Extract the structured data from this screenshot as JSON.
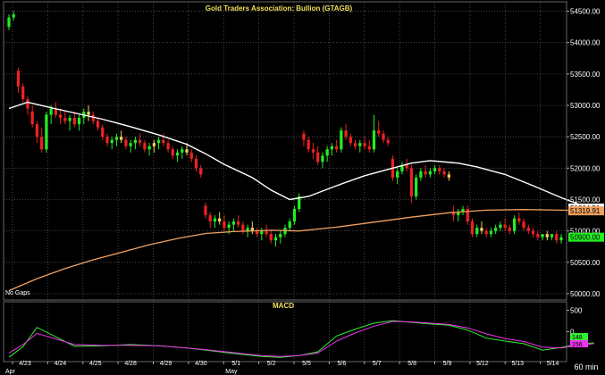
{
  "window": {
    "time_frame": "60 min"
  },
  "chart_data": [
    {
      "type": "candlestick",
      "title": "Gold Traders Association: Bullion (GTAGB)",
      "note": "No Gaps",
      "x_tick_labels": [
        "4/23",
        "4/24",
        "4/25",
        "4/28",
        "4/29",
        "4/30",
        "5/1",
        "5/2",
        "5/5",
        "5/6",
        "5/7",
        "5/8",
        "5/9",
        "5/12",
        "5/13",
        "5/14"
      ],
      "x_month_labels": [
        "Apr",
        "May"
      ],
      "y_tick_labels": [
        "50000.00",
        "50500.00",
        "51000.00",
        "51500.00",
        "52000.00",
        "52500.00",
        "53000.00",
        "53500.00",
        "54000.00",
        "54500.00"
      ],
      "ylim": [
        49900,
        54650
      ],
      "price_tags": {
        "last_price": "50900.00",
        "slow_average": "51319.91",
        "fast_average": "51364.51"
      },
      "colors": {
        "up": "#22ee22",
        "down": "#ee2222",
        "neutral": "#f0d060",
        "fast_average": "#ffffff",
        "slow_average": "#f0a060"
      },
      "candles": [
        [
          54250,
          54450,
          54200,
          54400
        ],
        [
          54400,
          54500,
          54350,
          54450
        ],
        [
          53550,
          53600,
          53200,
          53300
        ],
        [
          53300,
          53350,
          53050,
          53100
        ],
        [
          53100,
          53150,
          52850,
          52950
        ],
        [
          52900,
          53000,
          52650,
          52700
        ],
        [
          52700,
          52750,
          52400,
          52500
        ],
        [
          52500,
          52650,
          52250,
          52300
        ],
        [
          52300,
          52900,
          52250,
          52850
        ],
        [
          52850,
          53000,
          52700,
          52950
        ],
        [
          52950,
          53050,
          52800,
          52850
        ],
        [
          52850,
          52950,
          52700,
          52800
        ],
        [
          52800,
          52900,
          52700,
          52750
        ],
        [
          52750,
          52850,
          52600,
          52800
        ],
        [
          52800,
          52900,
          52650,
          52700
        ],
        [
          52700,
          52850,
          52600,
          52800
        ],
        [
          52800,
          52950,
          52700,
          52900
        ],
        [
          52900,
          53000,
          52750,
          52850
        ],
        [
          52850,
          52900,
          52700,
          52750
        ],
        [
          52750,
          52800,
          52600,
          52650
        ],
        [
          52650,
          52700,
          52450,
          52500
        ],
        [
          52500,
          52550,
          52350,
          52400
        ],
        [
          52400,
          52500,
          52300,
          52450
        ],
        [
          52450,
          52550,
          52350,
          52500
        ],
        [
          52500,
          52600,
          52400,
          52450
        ],
        [
          52450,
          52500,
          52300,
          52350
        ],
        [
          52350,
          52450,
          52250,
          52400
        ],
        [
          52400,
          52500,
          52300,
          52450
        ],
        [
          52450,
          52550,
          52350,
          52400
        ],
        [
          52400,
          52450,
          52250,
          52300
        ],
        [
          52300,
          52400,
          52200,
          52350
        ],
        [
          52350,
          52450,
          52250,
          52400
        ],
        [
          52400,
          52500,
          52300,
          52450
        ],
        [
          52450,
          52550,
          52350,
          52400
        ],
        [
          52400,
          52450,
          52250,
          52300
        ],
        [
          52300,
          52350,
          52150,
          52200
        ],
        [
          52200,
          52300,
          52100,
          52250
        ],
        [
          52250,
          52350,
          52150,
          52300
        ],
        [
          52300,
          52400,
          52200,
          52250
        ],
        [
          52250,
          52300,
          52100,
          52150
        ],
        [
          52150,
          52200,
          51950,
          52000
        ],
        [
          52000,
          52050,
          51850,
          51900
        ],
        [
          51400,
          51450,
          51200,
          51250
        ],
        [
          51250,
          51300,
          51050,
          51150
        ],
        [
          51150,
          51250,
          51050,
          51200
        ],
        [
          51200,
          51300,
          51100,
          51150
        ],
        [
          51150,
          51250,
          51000,
          51050
        ],
        [
          51050,
          51150,
          50950,
          51100
        ],
        [
          51100,
          51200,
          51000,
          51150
        ],
        [
          51150,
          51250,
          51050,
          51100
        ],
        [
          51100,
          51150,
          50950,
          51000
        ],
        [
          51000,
          51100,
          50900,
          51050
        ],
        [
          51050,
          51150,
          50950,
          51000
        ],
        [
          51000,
          51050,
          50900,
          50950
        ],
        [
          50950,
          51050,
          50850,
          51000
        ],
        [
          51000,
          51100,
          50900,
          50950
        ],
        [
          50950,
          51000,
          50800,
          50850
        ],
        [
          50850,
          50950,
          50750,
          50900
        ],
        [
          50900,
          51000,
          50800,
          50950
        ],
        [
          50950,
          51100,
          50900,
          51050
        ],
        [
          51050,
          51200,
          51000,
          51150
        ],
        [
          51150,
          51400,
          51100,
          51350
        ],
        [
          51350,
          51600,
          51300,
          51550
        ],
        [
          52550,
          52600,
          52350,
          52450
        ],
        [
          52450,
          52500,
          52250,
          52300
        ],
        [
          52300,
          52400,
          52150,
          52250
        ],
        [
          52250,
          52350,
          52050,
          52100
        ],
        [
          52100,
          52250,
          52000,
          52200
        ],
        [
          52200,
          52350,
          52100,
          52300
        ],
        [
          52300,
          52400,
          52200,
          52350
        ],
        [
          52350,
          52450,
          52250,
          52300
        ],
        [
          52300,
          52650,
          52250,
          52600
        ],
        [
          52600,
          52700,
          52450,
          52500
        ],
        [
          52500,
          52550,
          52350,
          52400
        ],
        [
          52400,
          52450,
          52300,
          52350
        ],
        [
          52350,
          52450,
          52250,
          52400
        ],
        [
          52400,
          52500,
          52300,
          52350
        ],
        [
          52350,
          52450,
          52250,
          52300
        ],
        [
          52300,
          52850,
          52250,
          52600
        ],
        [
          52600,
          52750,
          52500,
          52550
        ],
        [
          52550,
          52600,
          52400,
          52450
        ],
        [
          52450,
          52500,
          52350,
          52400
        ],
        [
          52150,
          52200,
          51800,
          51850
        ],
        [
          51850,
          52000,
          51750,
          51950
        ],
        [
          51950,
          52100,
          51900,
          52050
        ],
        [
          52050,
          52150,
          51950,
          52000
        ],
        [
          52000,
          52050,
          51450,
          51550
        ],
        [
          51550,
          51900,
          51500,
          51850
        ],
        [
          51850,
          52000,
          51800,
          51950
        ],
        [
          51950,
          52050,
          51850,
          51900
        ],
        [
          51900,
          52000,
          51850,
          51950
        ],
        [
          51950,
          52050,
          51900,
          52000
        ],
        [
          52000,
          52050,
          51900,
          51950
        ],
        [
          51950,
          52000,
          51850,
          51900
        ],
        [
          51900,
          51950,
          51800,
          51850
        ],
        [
          51300,
          51400,
          51150,
          51250
        ],
        [
          51250,
          51350,
          51150,
          51300
        ],
        [
          51300,
          51400,
          51250,
          51350
        ],
        [
          51350,
          51400,
          51100,
          51150
        ],
        [
          51150,
          51200,
          50900,
          50950
        ],
        [
          50950,
          51100,
          50900,
          51050
        ],
        [
          51050,
          51150,
          50950,
          51000
        ],
        [
          51000,
          51050,
          50900,
          50950
        ],
        [
          50950,
          51050,
          50900,
          51000
        ],
        [
          51000,
          51100,
          50950,
          51050
        ],
        [
          51050,
          51150,
          51000,
          51100
        ],
        [
          51100,
          51200,
          51000,
          51050
        ],
        [
          51050,
          51100,
          50950,
          51000
        ],
        [
          51000,
          51250,
          50950,
          51200
        ],
        [
          51200,
          51300,
          51100,
          51150
        ],
        [
          51150,
          51200,
          51000,
          51050
        ],
        [
          51050,
          51100,
          50950,
          51000
        ],
        [
          51000,
          51050,
          50900,
          50950
        ],
        [
          50950,
          51000,
          50850,
          50900
        ],
        [
          50900,
          50950,
          50850,
          50950
        ],
        [
          50950,
          51000,
          50850,
          50900
        ],
        [
          50900,
          50950,
          50850,
          50950
        ],
        [
          50950,
          51000,
          50800,
          50850
        ],
        [
          50850,
          50950,
          50800,
          50900
        ]
      ],
      "fast_average": [
        [
          0,
          52950
        ],
        [
          4,
          53050
        ],
        [
          8,
          52980
        ],
        [
          14,
          52880
        ],
        [
          20,
          52780
        ],
        [
          26,
          52660
        ],
        [
          32,
          52530
        ],
        [
          38,
          52380
        ],
        [
          42,
          52230
        ],
        [
          46,
          52060
        ],
        [
          52,
          51850
        ],
        [
          56,
          51650
        ],
        [
          60,
          51500
        ],
        [
          64,
          51550
        ],
        [
          70,
          51720
        ],
        [
          76,
          51880
        ],
        [
          82,
          52000
        ],
        [
          86,
          52080
        ],
        [
          90,
          52120
        ],
        [
          96,
          52080
        ],
        [
          100,
          52020
        ],
        [
          106,
          51900
        ],
        [
          112,
          51720
        ],
        [
          118,
          51530
        ],
        [
          122,
          51420
        ],
        [
          125,
          51364
        ]
      ],
      "slow_average": [
        [
          0,
          50050
        ],
        [
          6,
          50240
        ],
        [
          12,
          50400
        ],
        [
          18,
          50540
        ],
        [
          24,
          50660
        ],
        [
          30,
          50780
        ],
        [
          36,
          50880
        ],
        [
          42,
          50960
        ],
        [
          48,
          50990
        ],
        [
          56,
          51010
        ],
        [
          62,
          51000
        ],
        [
          70,
          51060
        ],
        [
          78,
          51140
        ],
        [
          86,
          51220
        ],
        [
          94,
          51290
        ],
        [
          102,
          51330
        ],
        [
          110,
          51340
        ],
        [
          118,
          51330
        ],
        [
          125,
          51320
        ]
      ]
    },
    {
      "type": "line",
      "title": "MACD",
      "y_tick_labels": [
        "500",
        "0"
      ],
      "value_tags": [
        "148",
        "156"
      ],
      "ylim": [
        -700,
        700
      ],
      "series": [
        {
          "color": "#33ee33",
          "values": [
            [
              0,
              -600
            ],
            [
              3,
              -350
            ],
            [
              6,
              100
            ],
            [
              10,
              -120
            ],
            [
              14,
              -340
            ],
            [
              20,
              -330
            ],
            [
              26,
              -300
            ],
            [
              32,
              -330
            ],
            [
              38,
              -380
            ],
            [
              42,
              -430
            ],
            [
              48,
              -510
            ],
            [
              54,
              -580
            ],
            [
              58,
              -600
            ],
            [
              62,
              -560
            ],
            [
              66,
              -470
            ],
            [
              70,
              -100
            ],
            [
              74,
              60
            ],
            [
              78,
              200
            ],
            [
              82,
              260
            ],
            [
              86,
              220
            ],
            [
              90,
              180
            ],
            [
              94,
              150
            ],
            [
              98,
              40
            ],
            [
              102,
              -150
            ],
            [
              106,
              -220
            ],
            [
              110,
              -280
            ],
            [
              114,
              -430
            ],
            [
              118,
              -370
            ],
            [
              121,
              -300
            ],
            [
              125,
              -260
            ]
          ]
        },
        {
          "color": "#ee33ee",
          "values": [
            [
              0,
              -500
            ],
            [
              3,
              -300
            ],
            [
              6,
              -40
            ],
            [
              10,
              -170
            ],
            [
              14,
              -300
            ],
            [
              20,
              -320
            ],
            [
              26,
              -320
            ],
            [
              32,
              -330
            ],
            [
              38,
              -380
            ],
            [
              42,
              -420
            ],
            [
              48,
              -490
            ],
            [
              54,
              -560
            ],
            [
              58,
              -580
            ],
            [
              62,
              -560
            ],
            [
              66,
              -500
            ],
            [
              70,
              -220
            ],
            [
              74,
              -30
            ],
            [
              78,
              130
            ],
            [
              82,
              240
            ],
            [
              86,
              230
            ],
            [
              90,
              200
            ],
            [
              94,
              170
            ],
            [
              98,
              90
            ],
            [
              102,
              -50
            ],
            [
              106,
              -160
            ],
            [
              110,
              -230
            ],
            [
              114,
              -360
            ],
            [
              118,
              -380
            ],
            [
              121,
              -330
            ],
            [
              125,
              -280
            ]
          ]
        }
      ]
    }
  ]
}
